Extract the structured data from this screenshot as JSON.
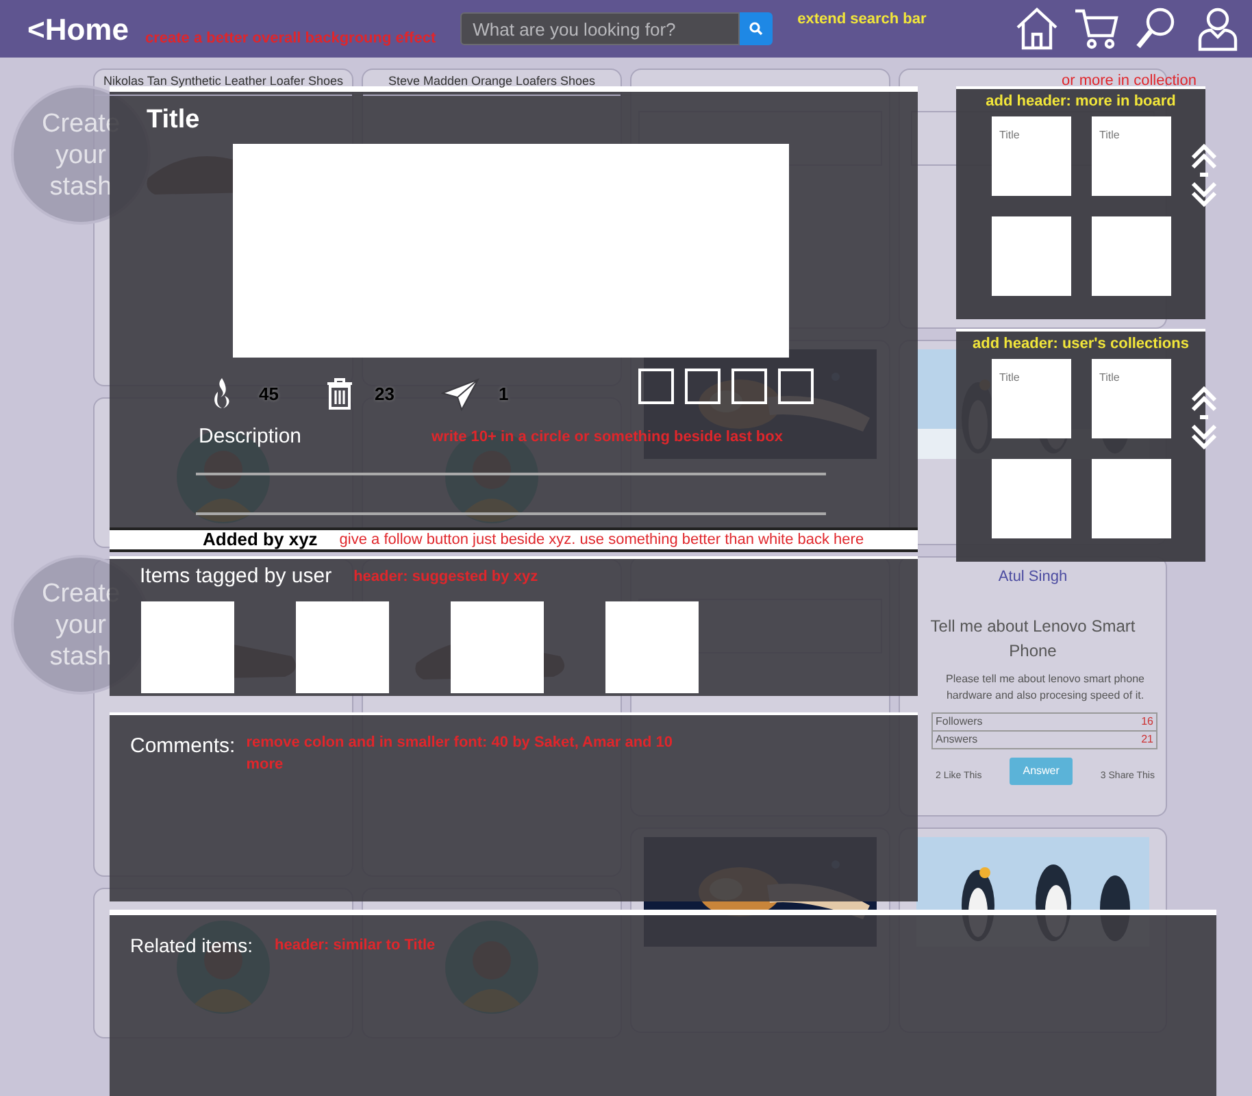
{
  "header": {
    "home_link": "<Home",
    "note": "create a better overall backgroung effect",
    "search": {
      "placeholder": "What are you looking for?"
    },
    "search_note": "extend search bar"
  },
  "feed": {
    "columns": [
      {
        "cards": [
          {
            "kind": "product",
            "title": "Nikolas Tan Synthetic Leather Loafer Shoes"
          },
          {
            "kind": "profile"
          },
          {
            "kind": "product"
          },
          {
            "kind": "profile"
          }
        ]
      },
      {
        "cards": [
          {
            "kind": "product",
            "title": "Steve Madden Orange Loafers Shoes"
          },
          {
            "kind": "profile"
          },
          {
            "kind": "product"
          },
          {
            "kind": "profile"
          }
        ]
      },
      {
        "cards": [
          {
            "kind": "question"
          },
          {
            "kind": "picture"
          },
          {
            "kind": "question"
          },
          {
            "kind": "picture"
          }
        ]
      },
      {
        "cards": [
          {
            "kind": "question"
          },
          {
            "kind": "picture"
          },
          {
            "kind": "question",
            "name": "Atul Singh",
            "question": "Tell me about Lenovo Smart Phone",
            "body": "Please tell me about lenovo smart phone hardware and also procesing speed of it.",
            "followers_label": "Followers",
            "answers_label": "Answers",
            "followers_count": "16",
            "answers_count": "21",
            "answer_button": "Answer",
            "likes": "2 Like This",
            "shares": "3 Share This"
          },
          {
            "kind": "picture"
          }
        ]
      }
    ],
    "stash_circles": [
      {
        "label": "Create your stash"
      },
      {
        "label": "Create your stash"
      }
    ]
  },
  "modal": {
    "title": "Title",
    "stats": [
      {
        "kind": "like",
        "count": "45"
      },
      {
        "kind": "delete",
        "count": "23"
      },
      {
        "kind": "share",
        "count": "1"
      }
    ],
    "description_label": "Description",
    "note": "write 10+ in a circle or something beside last box"
  },
  "added_by": {
    "text": "Added by xyz",
    "note": "give a follow button just beside xyz. use something better than white back here"
  },
  "tagged": {
    "heading": "Items tagged by user",
    "note": "header: suggested by xyz"
  },
  "comments": {
    "heading": "Comments:",
    "note": "remove colon and in smaller font: 40 by Saket, Amar and 10 more"
  },
  "related": {
    "heading": "Related items:",
    "note": "header: similar to Title"
  },
  "collection_note": "or more in collection",
  "side_panels": [
    {
      "note": "add header: more in board",
      "tile_titles": [
        "Title",
        "Title"
      ]
    },
    {
      "note": "add header: user's collections",
      "tile_titles": [
        "Title",
        "Title"
      ]
    }
  ]
}
